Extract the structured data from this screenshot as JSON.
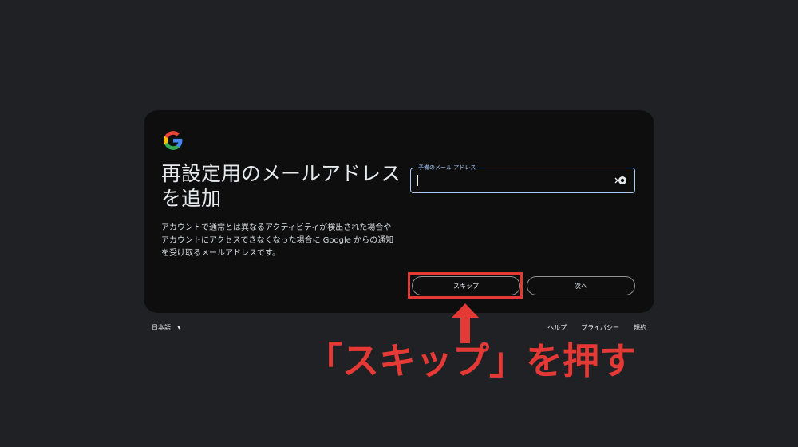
{
  "card": {
    "title": "再設定用のメールアドレスを追加",
    "description": "アカウントで通常とは異なるアクティビティが検出された場合やアカウントにアクセスできなくなった場合に Google からの通知を受け取るメールアドレスです。",
    "field": {
      "label": "予備のメール アドレス",
      "value": ""
    },
    "buttons": {
      "skip_label": "スキップ",
      "next_label": "次へ"
    }
  },
  "footer": {
    "language": "日本語",
    "links": [
      "ヘルプ",
      "プライバシー",
      "規約"
    ]
  },
  "annotation": {
    "text": "「スキップ」を押す",
    "color": "#e53935"
  },
  "icons": {
    "logo": "google-g-logo",
    "field": "password-manager-key-icon",
    "language": "chevron-down-icon",
    "arrow": "arrow-up-icon"
  }
}
